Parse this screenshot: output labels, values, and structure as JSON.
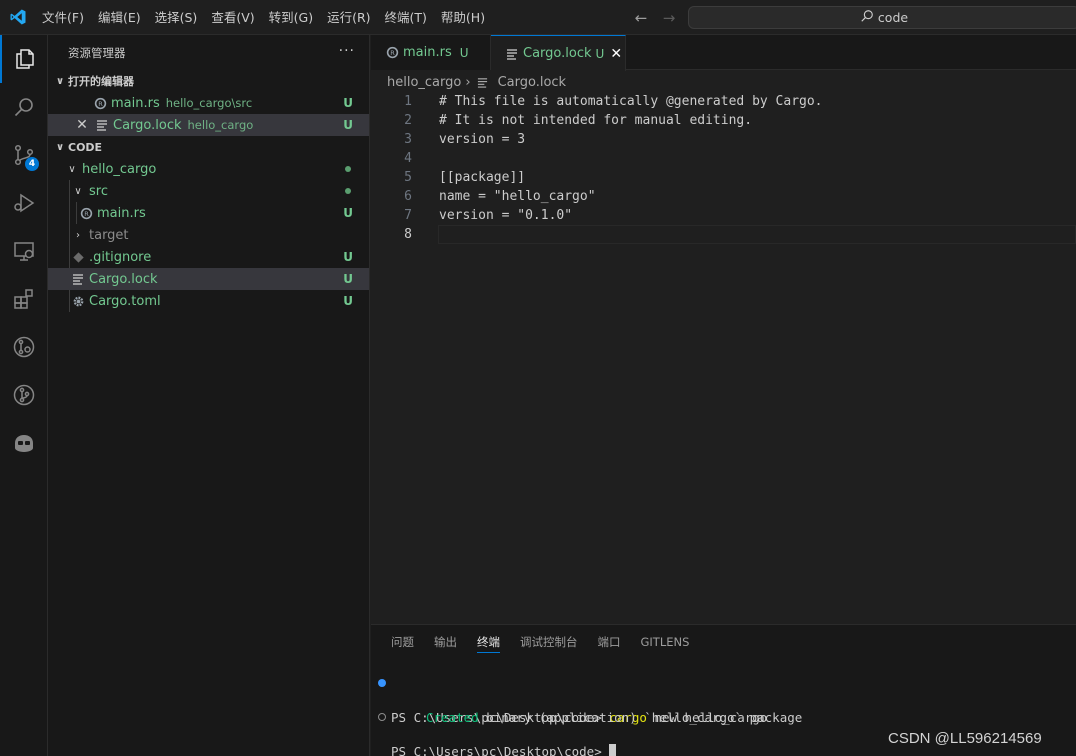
{
  "titlebar": {
    "menu": [
      "文件(F)",
      "编辑(E)",
      "选择(S)",
      "查看(V)",
      "转到(G)",
      "运行(R)",
      "终端(T)",
      "帮助(H)"
    ],
    "search_text": "code"
  },
  "activitybar": {
    "source_control_badge": "4"
  },
  "sidebar": {
    "title": "资源管理器",
    "more": "···",
    "open_editors_label": "打开的编辑器",
    "open_editors": [
      {
        "name": "main.rs",
        "desc": "hello_cargo\\src",
        "status": "U"
      },
      {
        "name": "Cargo.lock",
        "desc": "hello_cargo",
        "status": "U"
      }
    ],
    "folder_label": "CODE",
    "tree": {
      "hello_cargo": "hello_cargo",
      "src": "src",
      "main_rs": "main.rs",
      "target": "target",
      "gitignore": ".gitignore",
      "cargo_lock": "Cargo.lock",
      "cargo_toml": "Cargo.toml",
      "status_u": "U"
    }
  },
  "editor": {
    "tabs": [
      {
        "label": "main.rs",
        "status": "U"
      },
      {
        "label": "Cargo.lock",
        "status": "U"
      }
    ],
    "breadcrumb": [
      "hello_cargo",
      "Cargo.lock"
    ],
    "lines": [
      {
        "n": "1",
        "text": "# This file is automatically @generated by Cargo."
      },
      {
        "n": "2",
        "text": "# It is not intended for manual editing."
      },
      {
        "n": "3",
        "text": "version = 3"
      },
      {
        "n": "4",
        "text": ""
      },
      {
        "n": "5",
        "text": "[[package]]"
      },
      {
        "n": "6",
        "text": "name = \"hello_cargo\""
      },
      {
        "n": "7",
        "text": "version = \"0.1.0\""
      },
      {
        "n": "8",
        "text": ""
      }
    ]
  },
  "panel": {
    "tabs": [
      "问题",
      "输出",
      "终端",
      "调试控制台",
      "端口",
      "GITLENS"
    ],
    "terminal": {
      "prompt1": "PS C:\\Users\\pc\\Desktop\\code> ",
      "cmd": "cargo",
      "args": " new hello_cargo",
      "created": "Created",
      "created_rest": " binary (application) `hello_cargo` package",
      "prompt2": "PS C:\\Users\\pc\\Desktop\\code> "
    }
  },
  "watermark": "CSDN @LL596214569",
  "colors": {
    "accent": "#0078d4",
    "untracked": "#73c991"
  }
}
